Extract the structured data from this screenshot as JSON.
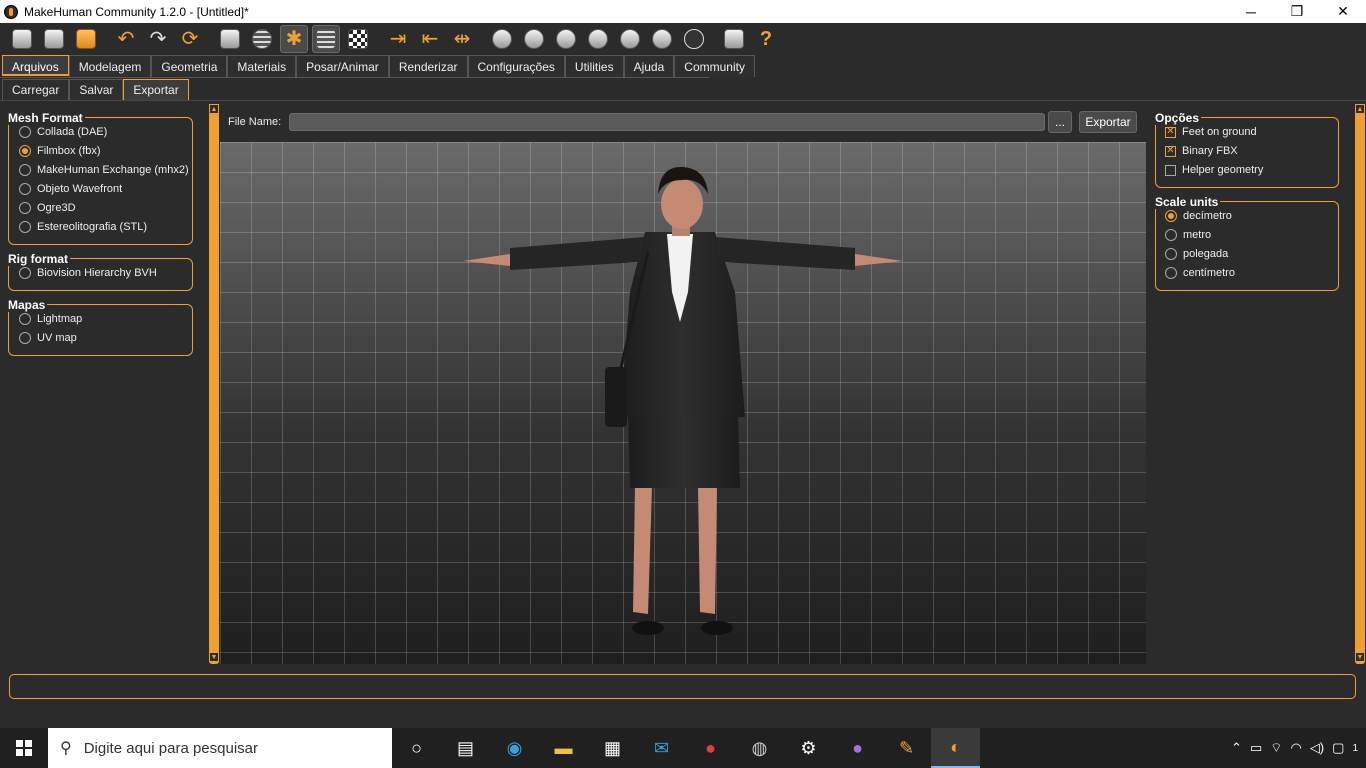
{
  "window": {
    "title": "MakeHuman Community 1.2.0 - [Untitled]*",
    "minimize": "─",
    "restore": "❐",
    "close": "✕"
  },
  "toolbar": {
    "icons": [
      "file-icon",
      "save-icon",
      "export-icon",
      "undo-icon",
      "redo-icon",
      "reset-icon",
      "wireframe-icon",
      "mesh-icon",
      "pose-icon",
      "grid-icon",
      "checker-icon",
      "symmetry-right-icon",
      "symmetry-left-icon",
      "symmetry-icon",
      "front-view-icon",
      "back-view-icon",
      "left-view-icon",
      "right-view-icon",
      "top-view-icon",
      "bottom-view-icon",
      "reset-camera-icon",
      "screenshot-icon",
      "help-icon"
    ]
  },
  "tabs": [
    "Arquivos",
    "Modelagem",
    "Geometria",
    "Materiais",
    "Posar/Animar",
    "Renderizar",
    "Configurações",
    "Utilities",
    "Ajuda",
    "Community"
  ],
  "subtabs": [
    "Carregar",
    "Salvar",
    "Exportar"
  ],
  "left": {
    "mesh_format": {
      "title": "Mesh Format",
      "options": [
        "Collada (DAE)",
        "Filmbox (fbx)",
        "MakeHuman Exchange (mhx2)",
        "Objeto Wavefront",
        "Ogre3D",
        "Estereolitografia (STL)"
      ],
      "selected": 1
    },
    "rig_format": {
      "title": "Rig format",
      "options": [
        "Biovision Hierarchy BVH"
      ]
    },
    "maps": {
      "title": "Mapas",
      "options": [
        "Lightmap",
        "UV map"
      ]
    }
  },
  "center": {
    "file_label": "File Name:",
    "file_value": "",
    "browse_label": "...",
    "export_label": "Exportar"
  },
  "right": {
    "options": {
      "title": "Opções",
      "items": [
        {
          "label": "Feet on ground",
          "checked": true
        },
        {
          "label": "Binary FBX",
          "checked": true
        },
        {
          "label": "Helper geometry",
          "checked": false
        }
      ]
    },
    "scale_units": {
      "title": "Scale units",
      "options": [
        "decímetro",
        "metro",
        "polegada",
        "centímetro"
      ],
      "selected": 0
    }
  },
  "taskbar": {
    "search_placeholder": "Digite aqui para pesquisar",
    "apps": [
      "cortana-icon",
      "task-view-icon",
      "edge-icon",
      "file-explorer-icon",
      "store-icon",
      "mail-icon",
      "chrome-icon",
      "app-icon",
      "settings-icon",
      "app2-icon",
      "paint-icon",
      "makehuman-icon"
    ],
    "notification_count": "1"
  },
  "colors": {
    "accent": "#f0a030",
    "background": "#2b2b2b"
  }
}
